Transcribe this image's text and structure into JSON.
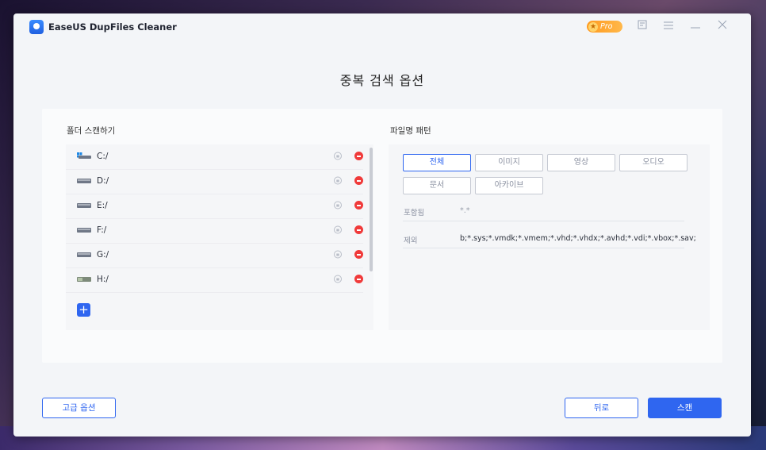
{
  "app": {
    "title": "EaseUS DupFiles Cleaner",
    "pro_label": "Pro"
  },
  "page": {
    "heading": "중복 검색 옵션"
  },
  "folder_scan": {
    "label": "폴더 스캔하기",
    "drives": [
      {
        "label": "C:/",
        "icon": "windows-drive-icon"
      },
      {
        "label": "D:/",
        "icon": "drive-icon"
      },
      {
        "label": "E:/",
        "icon": "drive-icon"
      },
      {
        "label": "F:/",
        "icon": "drive-icon"
      },
      {
        "label": "G:/",
        "icon": "drive-icon"
      },
      {
        "label": "H:/",
        "icon": "usb-drive-icon"
      }
    ],
    "add_label": "+"
  },
  "file_pattern": {
    "label": "파일명 패턴",
    "filters": [
      "전체",
      "이미지",
      "영상",
      "오디오",
      "문서",
      "아카이브"
    ],
    "active_filter": "전체",
    "include_label": "포함됨",
    "include_value": "*.*",
    "exclude_label": "제외",
    "exclude_value": "b;*.sys;*.vmdk;*.vmem;*.vhd;*.vhdx;*.avhd;*.vdi;*.vbox;*.sav;"
  },
  "footer": {
    "advanced_label": "고급 옵션",
    "back_label": "뒤로",
    "scan_label": "스캔"
  },
  "colors": {
    "accent": "#2f66f0",
    "remove": "#f03a3a",
    "pro": "#ff9a1f"
  }
}
